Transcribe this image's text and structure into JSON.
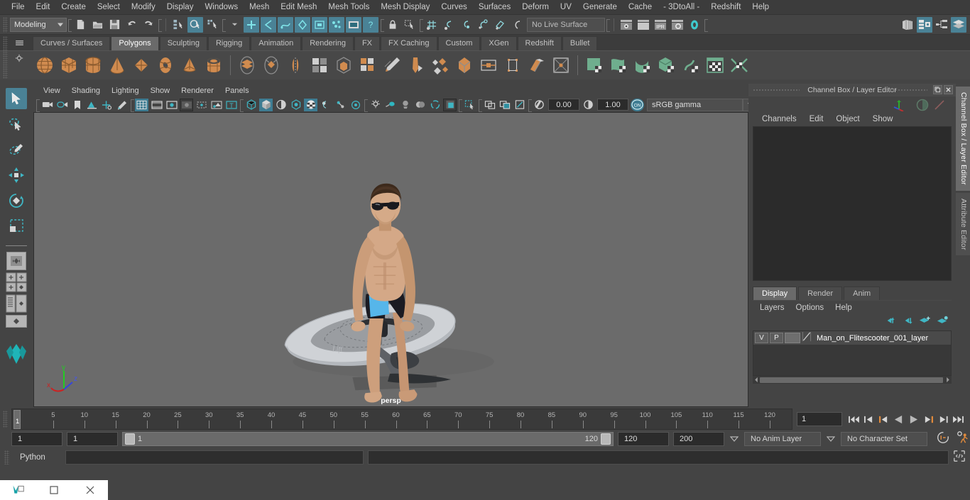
{
  "app": {
    "title": "Autodesk Maya"
  },
  "menubar": {
    "items": [
      "File",
      "Edit",
      "Create",
      "Select",
      "Modify",
      "Display",
      "Windows",
      "Mesh",
      "Edit Mesh",
      "Mesh Tools",
      "Mesh Display",
      "Curves",
      "Surfaces",
      "Deform",
      "UV",
      "Generate",
      "Cache",
      "- 3DtoAll -",
      "Redshift",
      "Help"
    ]
  },
  "statusline": {
    "menuset": "Modeling",
    "live_surface": "No Live Surface",
    "file_icons": [
      "new-scene-icon",
      "open-scene-icon",
      "save-scene-icon",
      "undo-icon",
      "redo-icon"
    ],
    "selmask_icons": [
      "select-by-hierarchy-icon",
      "select-by-object-icon",
      "select-by-component-icon"
    ],
    "mask_icons": [
      "handles-mask-icon",
      "curves-mask-icon",
      "surfaces-mask-icon",
      "deformers-mask-icon",
      "lattice-mask-icon",
      "particles-mask-icon",
      "image-planes-mask-icon",
      "misc-mask-icon"
    ],
    "lock_icons": [
      "lock-selection-icon",
      "highlight-selection-icon"
    ],
    "snap_icons": [
      "snap-to-grid-icon",
      "snap-to-curve-icon",
      "snap-to-point-icon",
      "snap-to-projected-center-icon",
      "snap-to-view-plane-icon",
      "make-live-icon"
    ],
    "render_icons": [
      "render-current-frame-icon",
      "ipr-render-icon",
      "ipr-refresh-icon",
      "render-settings-icon",
      "hypershade-icon"
    ],
    "editor_icons": [
      "open-outliner-icon",
      "open-node-editor-icon",
      "open-hypergraph-icon",
      "open-attribute-editor-icon"
    ]
  },
  "shelf": {
    "tabs": [
      "Curves / Surfaces",
      "Polygons",
      "Sculpting",
      "Rigging",
      "Animation",
      "Rendering",
      "FX",
      "FX Caching",
      "Custom",
      "XGen",
      "Redshift",
      "Bullet"
    ],
    "active_tab": "Polygons",
    "icons_orange": [
      "poly-sphere-icon",
      "poly-cube-icon",
      "poly-cylinder-icon",
      "poly-cone-icon",
      "poly-plane-icon",
      "poly-torus-icon",
      "poly-pyramid-icon",
      "poly-pipe-icon"
    ],
    "icons_gray": [
      "combine-icon",
      "separate-icon",
      "mirror-geometry-icon",
      "bevel-icon",
      "extrude-icon",
      "multi-cut-icon",
      "smooth-icon",
      "booleans-icon",
      "reduce-icon",
      "quad-draw-icon",
      "target-weld-icon",
      "append-polygon-icon",
      "insert-edge-loop-icon",
      "offset-edge-loop-icon"
    ],
    "icons_green": [
      "uv-editor-icon",
      "planar-map-icon",
      "cylindrical-map-icon",
      "automatic-map-icon",
      "unfold-uv-icon",
      "uv-snapshot-icon",
      "cut-uv-icon"
    ]
  },
  "viewport": {
    "menu": [
      "View",
      "Shading",
      "Lighting",
      "Show",
      "Renderer",
      "Panels"
    ],
    "camera_label": "persp",
    "exposure": "0.00",
    "gamma": "1.00",
    "color_management": "sRGB gamma",
    "cm_toggle": "ON",
    "axis": {
      "x": "x",
      "y": "y",
      "z": "z",
      "x_color": "#cc2222",
      "y_color": "#22cc22",
      "z_color": "#3344dd"
    },
    "bg_color": "#6b6b6b",
    "left_icons": [
      "select-camera-icon",
      "camera-attributes-icon",
      "bookmark-icon",
      "image-plane-icon",
      "2d-pan-zoom-icon",
      "grease-pencil-icon"
    ],
    "display_icons": [
      "grid-toggle-icon",
      "film-gate-icon",
      "resolution-gate-icon",
      "gate-mask-icon",
      "film-origin-icon",
      "safe-action-icon",
      "texture-border-icon"
    ],
    "shading_icons": [
      "wireframe-icon",
      "smooth-shade-icon",
      "shaded-wireframe-icon",
      "hardware-texturing-icon",
      "use-default-material-icon",
      "xray-icon",
      "xray-joints-icon",
      "xray-active-components-icon"
    ],
    "light_icons": [
      "no-lights-icon",
      "default-lighting-icon",
      "all-lights-icon",
      "shadows-icon",
      "screen-space-ao-icon",
      "motion-blur-icon",
      "multisample-aa-icon"
    ],
    "isolate_icons": [
      "isolate-select-icon",
      "selection-mask-icon"
    ],
    "panel_icons": [
      "single-perspective-icon",
      "four-view-icon",
      "outliner-persp-icon"
    ]
  },
  "channelbox": {
    "title": "Channel Box / Layer Editor",
    "menu": [
      "Channels",
      "Edit",
      "Object",
      "Show"
    ],
    "restore_icon": "restore-panel-icon",
    "close_icon": "close-panel-icon",
    "gizmo_icons": [
      "axis-gizmo-icon",
      "circle-gizmo-icon",
      "slash-gizmo-icon"
    ]
  },
  "layereditor": {
    "tabs": [
      "Display",
      "Render",
      "Anim"
    ],
    "active_tab": "Display",
    "menu": [
      "Layers",
      "Options",
      "Help"
    ],
    "buttons": [
      "move-layer-up-icon",
      "move-layer-down-icon",
      "new-layer-icon",
      "new-layer-from-selected-icon"
    ],
    "layers": [
      {
        "visible": "V",
        "playback": "P",
        "color": "",
        "name": "Man_on_Flitescooter_001_layer"
      }
    ]
  },
  "sidetabs": {
    "items": [
      "Channel Box / Layer Editor",
      "Attribute Editor"
    ],
    "active": "Channel Box / Layer Editor"
  },
  "timeline": {
    "ticks": [
      5,
      10,
      15,
      20,
      25,
      30,
      35,
      40,
      45,
      50,
      55,
      60,
      65,
      70,
      75,
      80,
      85,
      90,
      95,
      100,
      105,
      110,
      115,
      120
    ],
    "start": 1,
    "end": 120,
    "current_frame": "1",
    "current_field": "1",
    "playback_icons": [
      "go-to-start-icon",
      "step-back-keyframe-icon",
      "step-back-frame-icon",
      "play-backwards-icon",
      "play-forwards-icon",
      "step-forward-frame-icon",
      "step-forward-keyframe-icon",
      "go-to-end-icon"
    ]
  },
  "rangeslider": {
    "anim_start": "1",
    "range_start": "1",
    "slider_start": "1",
    "slider_end": "120",
    "range_end": "120",
    "anim_end": "200",
    "anim_layer": "No Anim Layer",
    "character_set": "No Character Set",
    "right_icons": [
      "auto-key-icon",
      "animation-preferences-icon"
    ]
  },
  "commandline": {
    "language": "Python",
    "input_value": "",
    "script-editor-icon": "script-editor-icon"
  },
  "taskbar": {
    "items": [
      "maya-app-icon",
      "restore-window-icon",
      "maximize-window-icon",
      "close-window-icon"
    ]
  },
  "colors": {
    "accent_blue": "#4a8296",
    "accent_orange": "#d08b4f",
    "accent_green": "#6fae8e",
    "panel_bg": "#444444",
    "viewport_bg": "#6b6b6b"
  }
}
